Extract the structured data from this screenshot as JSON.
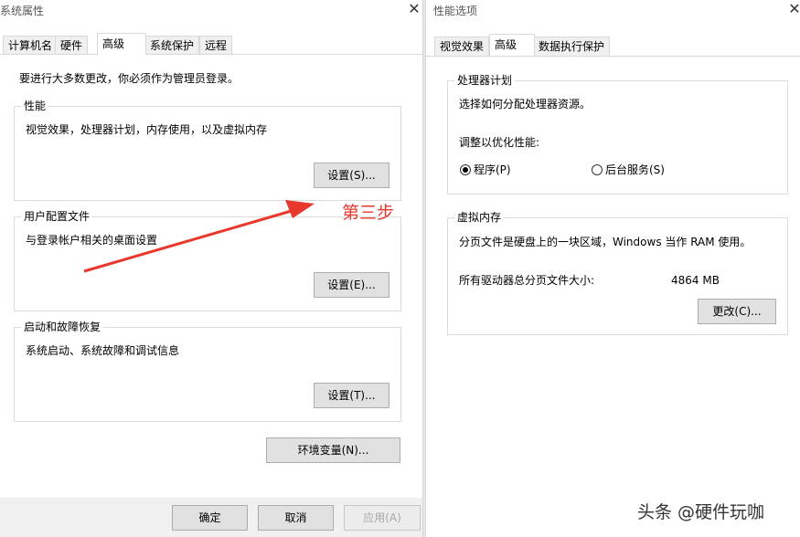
{
  "left_window": {
    "title": "系统属性",
    "tabs": [
      "计算机名",
      "硬件",
      "高级",
      "系统保护",
      "远程"
    ],
    "notice": "要进行大多数更改，你必须作为管理员登录。",
    "performance": {
      "label": "性能",
      "desc": "视觉效果，处理器计划，内存使用，以及虚拟内存",
      "button": "设置(S)..."
    },
    "user_profiles": {
      "label": "用户配置文件",
      "desc": "与登录帐户相关的桌面设置",
      "button": "设置(E)..."
    },
    "startup_recovery": {
      "label": "启动和故障恢复",
      "desc": "系统启动、系统故障和调试信息",
      "button": "设置(T)..."
    },
    "env_button": "环境变量(N)...",
    "footer": {
      "ok": "确定",
      "cancel": "取消",
      "apply": "应用(A)"
    }
  },
  "right_window": {
    "title": "性能选项",
    "tabs": [
      "视觉效果",
      "高级",
      "数据执行保护"
    ],
    "processor": {
      "label": "处理器计划",
      "desc": "选择如何分配处理器资源。",
      "adjust": "调整以优化性能:",
      "options": [
        "程序(P)",
        "后台服务(S)"
      ],
      "selected": "程序(P)"
    },
    "virtual_memory": {
      "label": "虚拟内存",
      "desc": "分页文件是硬盘上的一块区域，Windows 当作 RAM 使用。",
      "total_label": "所有驱动器总分页文件大小:",
      "total_value": "4864 MB",
      "change_button": "更改(C)..."
    }
  },
  "annotation": {
    "text": "第三步",
    "color": "#e8382d"
  },
  "watermark": "头条 @硬件玩咖",
  "icons": {
    "close": "close-icon",
    "radio": "radio-button"
  }
}
